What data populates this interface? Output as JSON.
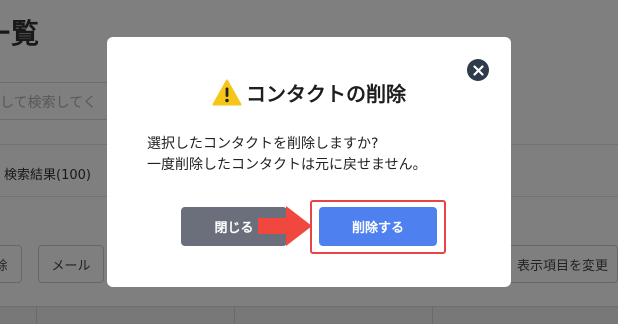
{
  "background": {
    "page_title": "一覧",
    "search_placeholder": "して検索してく",
    "results_label": "検索結果(100)",
    "buttons": {
      "delete": "除",
      "mail": "メール",
      "columns": "表示項目を変更"
    }
  },
  "modal": {
    "icon": "warning-icon",
    "title": "コンタクトの削除",
    "body_line1": "選択したコンタクトを削除しますか?",
    "body_line2": "一度削除したコンタクトは元に戻せません。",
    "close_button_label": "閉じる",
    "delete_button_label": "削除する",
    "close_icon": "close-icon",
    "colors": {
      "primary": "#4f80f0",
      "secondary": "#6b6f7c",
      "highlight": "#e94444",
      "warning": "#f5c518"
    }
  }
}
